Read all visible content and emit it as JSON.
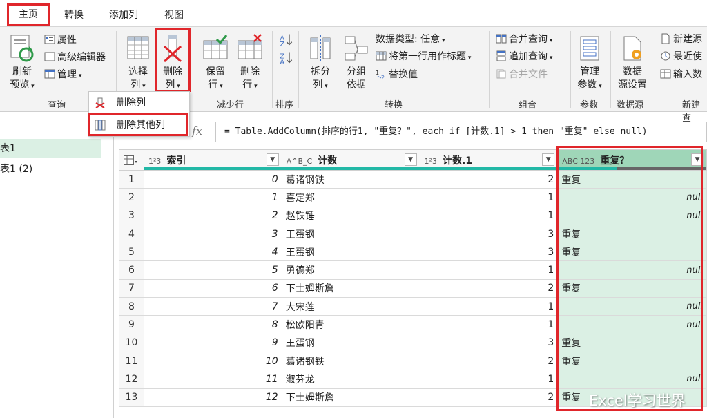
{
  "tabs": [
    "主页",
    "转换",
    "添加列",
    "视图"
  ],
  "ribbon": {
    "query": {
      "refresh": "刷新\n预览",
      "refresh_l1": "刷新",
      "refresh_l2": "预览",
      "properties": "属性",
      "advanced_editor": "高级编辑器",
      "manage": "管理",
      "group": "查询"
    },
    "columns": {
      "choose_l1": "选择",
      "choose_l2": "列",
      "remove_l1": "删除",
      "remove_l2": "列"
    },
    "reduce_rows": {
      "keep_l1": "保留",
      "keep_l2": "行",
      "remove_l1": "删除",
      "remove_l2": "行",
      "group": "减少行"
    },
    "sort": {
      "group": "排序"
    },
    "transform": {
      "split_l1": "拆分",
      "split_l2": "列",
      "groupby_l1": "分组",
      "groupby_l2": "依据",
      "datatype": "数据类型: 任意",
      "first_row_header": "将第一行用作标题",
      "replace_values": "替换值",
      "group": "转换"
    },
    "combine": {
      "merge_queries": "合并查询",
      "append_queries": "追加查询",
      "combine_files": "合并文件",
      "group": "组合"
    },
    "parameters": {
      "manage_l1": "管理",
      "manage_l2": "参数",
      "group": "参数"
    },
    "datasource": {
      "settings_l1": "数据",
      "settings_l2": "源设置",
      "group": "数据源"
    },
    "newquery": {
      "new_source": "新建源",
      "recent_sources": "最近使",
      "enter_data": "输入数",
      "group": "新建查"
    }
  },
  "dropdown": {
    "items": [
      "删除列",
      "删除其他列"
    ]
  },
  "queries": [
    "表1",
    "表1 (2)"
  ],
  "formula": {
    "fx": "fx",
    "text": "= Table.AddColumn(排序的行1, \"重复？\", each if [计数.1] > 1 then \"重复\" else null)"
  },
  "grid": {
    "columns": [
      {
        "type": "1²3",
        "name": "索引"
      },
      {
        "type": "A^B_C",
        "name": "计数"
      },
      {
        "type": "1²3",
        "name": "计数.1"
      },
      {
        "type": "ABC 123",
        "name": "重复？"
      }
    ],
    "rows": [
      {
        "n": "1",
        "idx": "0",
        "name": "葛诸钢铁",
        "c": "2",
        "rep": "重复"
      },
      {
        "n": "2",
        "idx": "1",
        "name": "喜定郑",
        "c": "1",
        "rep": "null"
      },
      {
        "n": "3",
        "idx": "2",
        "name": "赵铁锤",
        "c": "1",
        "rep": "null"
      },
      {
        "n": "4",
        "idx": "3",
        "name": "王蛋钢",
        "c": "3",
        "rep": "重复"
      },
      {
        "n": "5",
        "idx": "4",
        "name": "王蛋钢",
        "c": "3",
        "rep": "重复"
      },
      {
        "n": "6",
        "idx": "5",
        "name": "勇德郑",
        "c": "1",
        "rep": "null"
      },
      {
        "n": "7",
        "idx": "6",
        "name": "下士姆斯詹",
        "c": "2",
        "rep": "重复"
      },
      {
        "n": "8",
        "idx": "7",
        "name": "大宋莲",
        "c": "1",
        "rep": "null"
      },
      {
        "n": "9",
        "idx": "8",
        "name": "松欧阳青",
        "c": "1",
        "rep": "null"
      },
      {
        "n": "10",
        "idx": "9",
        "name": "王蛋钢",
        "c": "3",
        "rep": "重复"
      },
      {
        "n": "11",
        "idx": "10",
        "name": "葛诸钢铁",
        "c": "2",
        "rep": "重复"
      },
      {
        "n": "12",
        "idx": "11",
        "name": "淑芬龙",
        "c": "1",
        "rep": "null"
      },
      {
        "n": "13",
        "idx": "12",
        "name": "下士姆斯詹",
        "c": "2",
        "rep": "重复"
      }
    ]
  },
  "watermark": "Excel学习世界",
  "colors": {
    "highlight": "#e0262b",
    "accent": "#22b8a6",
    "new_column": "#dbf0e4"
  }
}
